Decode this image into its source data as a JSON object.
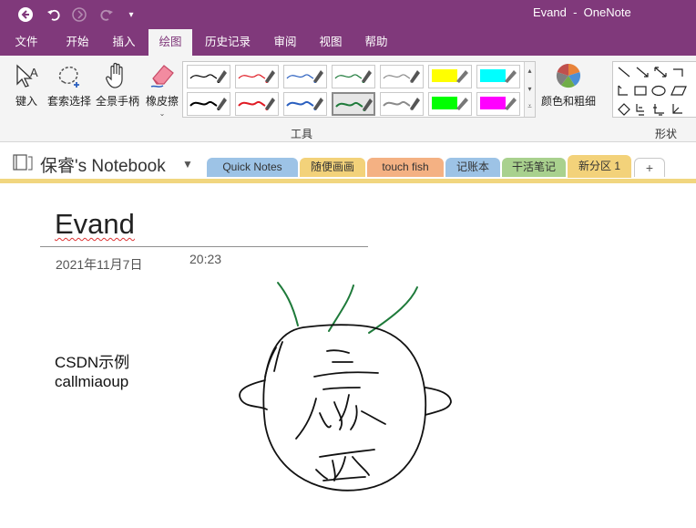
{
  "window": {
    "title": "Evand  -  OneNote"
  },
  "menu": {
    "tabs": [
      "文件",
      "开始",
      "插入",
      "绘图",
      "历史记录",
      "审阅",
      "视图",
      "帮助"
    ],
    "active": "绘图"
  },
  "ribbon": {
    "type_label": "键入",
    "lasso_label": "套索选择",
    "panning_label": "全景手柄",
    "eraser_label": "橡皮擦",
    "color_thickness_label": "颜色和粗细",
    "tools_group_label": "工具",
    "shapes_group_label": "形状",
    "pens_row1": [
      "#000000",
      "#e01b24",
      "#2a5fbf",
      "#1e7a3a",
      "#8a8a8a",
      "#ffff00",
      "#00ffff"
    ],
    "pens_row2": [
      "#000000",
      "#e01b24",
      "#2a5fbf",
      "#1e7a3a",
      "#8a8a8a",
      "#00ff00",
      "#ff00ff"
    ],
    "selected_pen": "row2-4"
  },
  "notebook": {
    "name": "保睿's Notebook"
  },
  "sections": [
    {
      "label": "Quick Notes",
      "color": "#9dc3e6"
    },
    {
      "label": "随便画画",
      "color": "#f3d27a"
    },
    {
      "label": "touch fish",
      "color": "#f4b183"
    },
    {
      "label": "记账本",
      "color": "#9dc3e6"
    },
    {
      "label": "干活笔记",
      "color": "#a9d18e"
    },
    {
      "label": "新分区 1",
      "color": "#f3d27a"
    }
  ],
  "add_section_label": "+",
  "page": {
    "title": "Evand",
    "date": "2021年11月7日",
    "time": "20:23",
    "notes": [
      "CSDN示例",
      "callmiaoup"
    ]
  }
}
